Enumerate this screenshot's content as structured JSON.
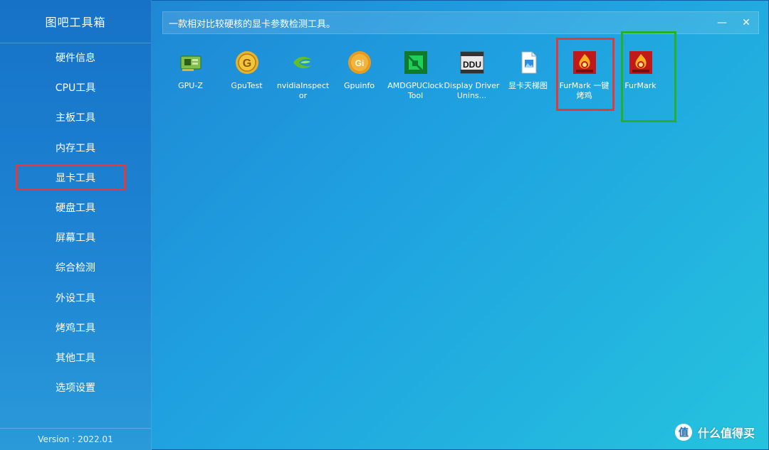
{
  "app": {
    "title": "图吧工具箱",
    "version": "Version : 2022.01",
    "header_text": "一款相对比较硬核的显卡参数检测工具。",
    "minimize": "—",
    "close": "✕"
  },
  "sidebar": {
    "items": [
      {
        "label": "硬件信息"
      },
      {
        "label": "CPU工具"
      },
      {
        "label": "主板工具"
      },
      {
        "label": "内存工具"
      },
      {
        "label": "显卡工具",
        "selected": true
      },
      {
        "label": "硬盘工具"
      },
      {
        "label": "屏幕工具"
      },
      {
        "label": "综合检测"
      },
      {
        "label": "外设工具"
      },
      {
        "label": "烤鸡工具"
      },
      {
        "label": "其他工具"
      },
      {
        "label": "选项设置"
      }
    ]
  },
  "tools": [
    {
      "label": "GPU-Z",
      "icon": "gpu-card-icon"
    },
    {
      "label": "GpuTest",
      "icon": "g-gear-icon"
    },
    {
      "label": "nvidiaInspector",
      "icon": "nvidia-icon"
    },
    {
      "label": "Gpuinfo",
      "icon": "gi-gear-icon"
    },
    {
      "label": "AMDGPUClockTool",
      "icon": "amd-icon"
    },
    {
      "label": "Display Driver Unins...",
      "icon": "ddu-icon"
    },
    {
      "label": "显卡天梯图",
      "icon": "image-file-icon"
    },
    {
      "label": "FurMark 一键烤鸡",
      "icon": "furmark-icon"
    },
    {
      "label": "FurMark",
      "icon": "furmark-icon"
    }
  ],
  "watermark": {
    "badge": "值",
    "text": "什么值得买"
  },
  "colors": {
    "annotation_red": "#e53935",
    "annotation_green": "#25b02a"
  }
}
